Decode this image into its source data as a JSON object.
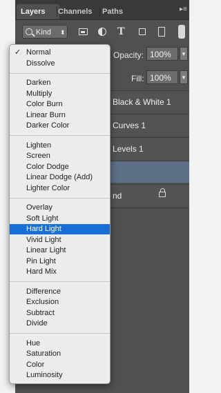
{
  "tabs": [
    "Layers",
    "Channels",
    "Paths"
  ],
  "filter": {
    "kind_label": "Kind",
    "icons": [
      "search-icon",
      "pixel-layer-filter-icon",
      "adjustment-layer-filter-icon",
      "type-layer-filter-icon",
      "shape-layer-filter-icon",
      "smart-object-filter-icon"
    ]
  },
  "opacity": {
    "label": "Opacity:",
    "value": "100%"
  },
  "fill": {
    "label": "Fill:",
    "value": "100%"
  },
  "layers": [
    {
      "name": "Black & White 1"
    },
    {
      "name": "Curves 1"
    },
    {
      "name": "Levels 1"
    },
    {
      "name": ""
    },
    {
      "name": "nd",
      "locked": true
    }
  ],
  "blend_menu": {
    "checked": "Normal",
    "highlighted": "Hard Light",
    "groups": [
      [
        "Normal",
        "Dissolve"
      ],
      [
        "Darken",
        "Multiply",
        "Color Burn",
        "Linear Burn",
        "Darker Color"
      ],
      [
        "Lighten",
        "Screen",
        "Color Dodge",
        "Linear Dodge (Add)",
        "Lighter Color"
      ],
      [
        "Overlay",
        "Soft Light",
        "Hard Light",
        "Vivid Light",
        "Linear Light",
        "Pin Light",
        "Hard Mix"
      ],
      [
        "Difference",
        "Exclusion",
        "Subtract",
        "Divide"
      ],
      [
        "Hue",
        "Saturation",
        "Color",
        "Luminosity"
      ]
    ]
  },
  "colors": {
    "panel_bg": "#505050",
    "menu_bg": "#ececec",
    "highlight": "#1a6fd6",
    "selected_layer": "#5c6f86"
  }
}
